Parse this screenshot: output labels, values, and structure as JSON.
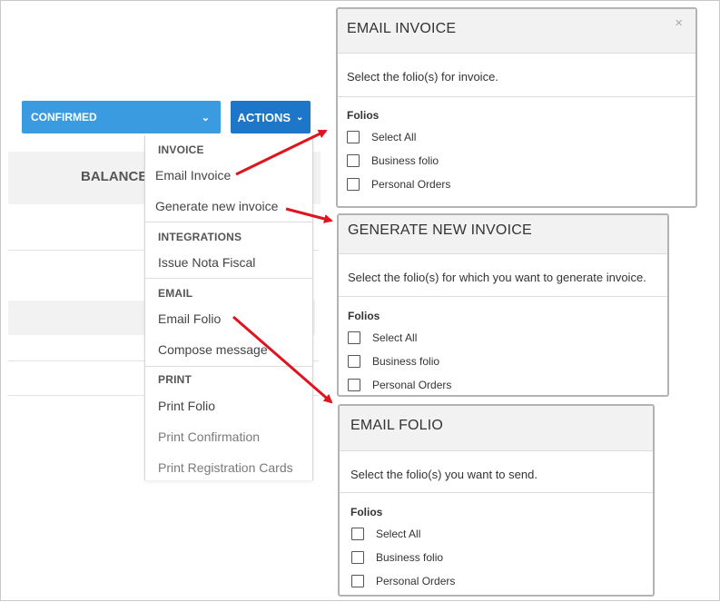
{
  "status": {
    "label": "CONFIRMED",
    "chevron_icon": "chevron-down-icon"
  },
  "actions": {
    "label": "ACTIONS",
    "chevron_icon": "chevron-down-icon"
  },
  "background": {
    "balance_label": "BALANCE"
  },
  "menu": {
    "invoice_header": "INVOICE",
    "email_invoice": "Email Invoice",
    "generate_new_invoice": "Generate new invoice",
    "integrations_header": "INTEGRATIONS",
    "issue_nota_fiscal": "Issue Nota Fiscal",
    "email_header": "EMAIL",
    "email_folio": "Email Folio",
    "compose_message": "Compose message",
    "print_header": "PRINT",
    "print_folio": "Print Folio",
    "print_confirmation": "Print Confirmation",
    "print_registration_cards": "Print Registration Cards"
  },
  "dialogs": {
    "email_invoice": {
      "title": "EMAIL INVOICE",
      "close": "×",
      "description": "Select the folio(s) for invoice.",
      "folios_label": "Folios",
      "options": [
        "Select All",
        "Business folio",
        "Personal Orders"
      ]
    },
    "generate_invoice": {
      "title": "GENERATE NEW INVOICE",
      "description": "Select the folio(s) for which you want to generate invoice.",
      "folios_label": "Folios",
      "options": [
        "Select All",
        "Business folio",
        "Personal Orders"
      ]
    },
    "email_folio": {
      "title": "EMAIL FOLIO",
      "description": "Select the folio(s) you want to send.",
      "folios_label": "Folios",
      "options": [
        "Select All",
        "Business folio",
        "Personal Orders"
      ]
    }
  },
  "colors": {
    "status_bg": "#3b9be0",
    "actions_bg": "#1d76c7",
    "arrow": "#e0141e"
  }
}
